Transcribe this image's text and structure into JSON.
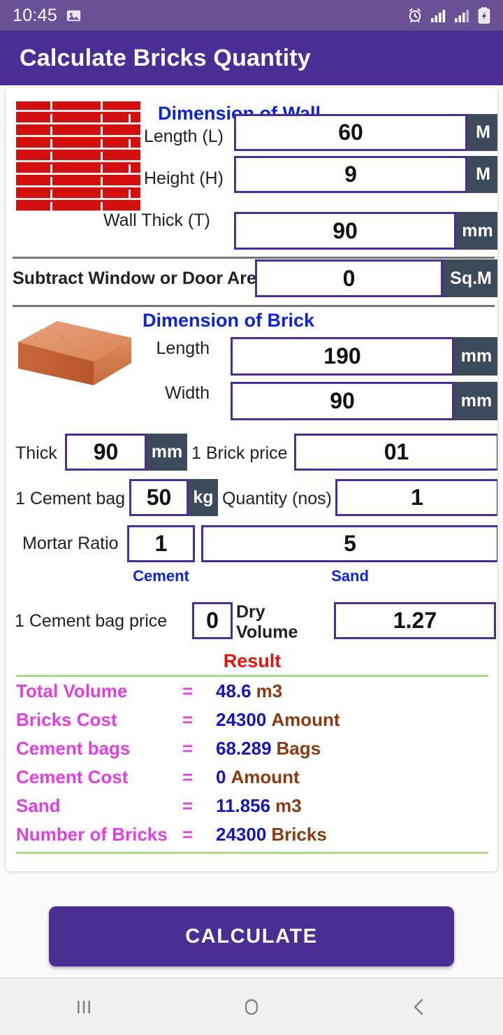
{
  "status_bar": {
    "time": "10:45",
    "icons": [
      "image-icon",
      "alarm-icon",
      "signal-bars-icon",
      "signal-bars-icon",
      "battery-charging-icon"
    ]
  },
  "app_bar": {
    "title": "Calculate Bricks Quantity"
  },
  "wall_section": {
    "title": "Dimension of Wall",
    "image": "brick-wall-image",
    "fields": [
      {
        "label": "Length (L)",
        "value": "60",
        "unit": "M"
      },
      {
        "label": "Height (H)",
        "value": "9",
        "unit": "M"
      },
      {
        "label": "Wall Thick (T)",
        "value": "90",
        "unit": "mm"
      }
    ]
  },
  "subtract_row": {
    "label": "Subtract Window or Door Area",
    "value": "0",
    "unit": "Sq.M"
  },
  "brick_section": {
    "title": "Dimension of Brick",
    "image": "brick-image",
    "fields": [
      {
        "label": "Length",
        "value": "190",
        "unit": "mm"
      },
      {
        "label": "Width",
        "value": "90",
        "unit": "mm"
      }
    ]
  },
  "thick_row": {
    "thick_label": "Thick",
    "thick_value": "90",
    "thick_unit": "mm",
    "price_label": "1 Brick price",
    "price_value": "01"
  },
  "cement_row": {
    "bag_label": "1 Cement bag",
    "bag_value": "50",
    "bag_unit": "kg",
    "qty_label": "Quantity (nos)",
    "qty_value": "1"
  },
  "mortar_row": {
    "label": "Mortar Ratio",
    "cement_value": "1",
    "cement_caption": "Cement",
    "sand_value": "5",
    "sand_caption": "Sand"
  },
  "price_row": {
    "bag_price_label": "1 Cement bag price",
    "bag_price_value": "0",
    "dry_volume_label": "Dry Volume",
    "dry_volume_value": "1.27"
  },
  "result": {
    "title": "Result",
    "rows": [
      {
        "label": "Total  Volume",
        "eq": "=",
        "value": "48.6",
        "unit": "m3"
      },
      {
        "label": "Bricks Cost",
        "eq": "=",
        "value": "24300",
        "unit": "Amount"
      },
      {
        "label": "Cement bags",
        "eq": "=",
        "value": "68.289",
        "unit": "Bags"
      },
      {
        "label": "Cement Cost",
        "eq": "=",
        "value": "0",
        "unit": "Amount"
      },
      {
        "label": "Sand",
        "eq": "=",
        "value": "11.856",
        "unit": "m3"
      },
      {
        "label": "Number of Bricks",
        "eq": "=",
        "value": "24300",
        "unit": "Bricks"
      }
    ]
  },
  "calculate_button": {
    "label": "CALCULATE"
  },
  "nav_bar": {
    "recents": "recents-icon",
    "home": "home-icon",
    "back": "back-icon"
  },
  "colors": {
    "app_bar": "#4b2e93",
    "status_bar": "#6a5196",
    "field_border": "#4b2e93",
    "unit_chip": "#3d4a5c",
    "section_title": "#0b24d6",
    "result_title": "#e8120c",
    "result_label": "#e23fe2",
    "result_value": "#1616b8",
    "result_unit": "#8c3b10",
    "result_rule": "#a8dd88",
    "brick_red": "#d40f0f"
  }
}
